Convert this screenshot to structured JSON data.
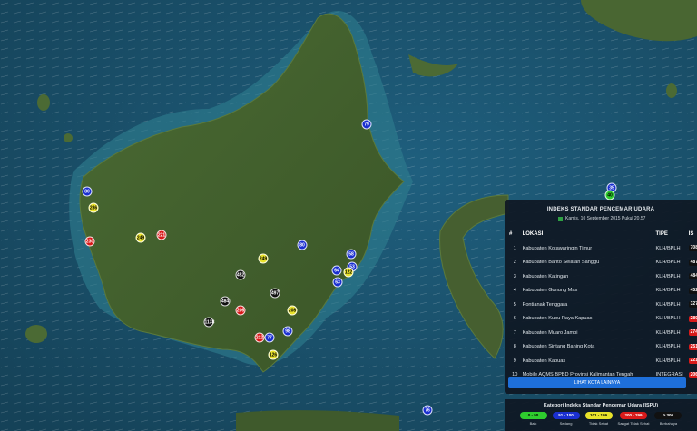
{
  "map": {
    "markers": [
      {
        "label": "79",
        "color": "#1a2fd0"
      },
      {
        "label": "80",
        "color": "#1a2fd0"
      },
      {
        "label": "286",
        "color": "#e8e22a"
      },
      {
        "label": "230",
        "color": "#d91a1a"
      },
      {
        "label": "249",
        "color": "#e8e22a"
      },
      {
        "label": "221",
        "color": "#d91a1a"
      },
      {
        "label": "80",
        "color": "#1a2fd0"
      },
      {
        "label": "58",
        "color": "#1a2fd0"
      },
      {
        "label": "249",
        "color": "#e8e22a"
      },
      {
        "label": "53",
        "color": "#1a2fd0"
      },
      {
        "label": "64",
        "color": "#1a2fd0"
      },
      {
        "label": "122",
        "color": "#e8e22a"
      },
      {
        "label": "63",
        "color": "#1a2fd0"
      },
      {
        "label": "452",
        "color": "#111111"
      },
      {
        "label": "497",
        "color": "#111111"
      },
      {
        "label": "484",
        "color": "#111111"
      },
      {
        "label": "206",
        "color": "#d91a1a"
      },
      {
        "label": "208",
        "color": "#e8e22a"
      },
      {
        "label": "1138",
        "color": "#111111"
      },
      {
        "label": "98",
        "color": "#1a2fd0"
      },
      {
        "label": "212",
        "color": "#d91a1a"
      },
      {
        "label": "77",
        "color": "#1a2fd0"
      },
      {
        "label": "126",
        "color": "#e8e22a"
      },
      {
        "label": "76",
        "color": "#1a2fd0"
      },
      {
        "label": "35",
        "color": "#1a2fd0"
      },
      {
        "label": "40",
        "color": "#2ecc2e"
      }
    ]
  },
  "panel": {
    "title": "INDEKS STANDAR PENCEMAR UDARA",
    "date": "Kamis, 10 September 2015 Pukul 20.57",
    "headers": {
      "num": "#",
      "loc": "LOKASI",
      "tipe": "TIPE",
      "ispu": "IS"
    },
    "rows": [
      {
        "num": "1",
        "loc": "Kabupaten Kotawaringin Timur",
        "tipe": "KLH/BPLH",
        "val": "708",
        "color": "#111111"
      },
      {
        "num": "2",
        "loc": "Kabupaten Barito Selatan Sanggu",
        "tipe": "KLH/BPLH",
        "val": "487",
        "color": "#111111"
      },
      {
        "num": "3",
        "loc": "Kabupaten Katingan",
        "tipe": "KLH/BPLH",
        "val": "484",
        "color": "#111111"
      },
      {
        "num": "4",
        "loc": "Kabupaten Gunung Mas",
        "tipe": "KLH/BPLH",
        "val": "452",
        "color": "#111111"
      },
      {
        "num": "5",
        "loc": "Pontianak Tenggara",
        "tipe": "KLH/BPLH",
        "val": "327",
        "color": "#111111"
      },
      {
        "num": "6",
        "loc": "Kabupaten Kubu Raya Kapuas",
        "tipe": "KLH/BPLH",
        "val": "280",
        "color": "#d91a1a"
      },
      {
        "num": "7",
        "loc": "Kabupaten Muaro Jambi",
        "tipe": "KLH/BPLH",
        "val": "274",
        "color": "#d91a1a"
      },
      {
        "num": "8",
        "loc": "Kabupaten Sintang Baning Kota",
        "tipe": "KLH/BPLH",
        "val": "251",
        "color": "#d91a1a"
      },
      {
        "num": "9",
        "loc": "Kabupaten Kapuas",
        "tipe": "KLH/BPLH",
        "val": "221",
        "color": "#d91a1a"
      },
      {
        "num": "10",
        "loc": "Mobile AQMS BPBD Provinsi Kalimantan Tengah",
        "tipe": "INTEGRASI",
        "val": "206",
        "color": "#d91a1a"
      }
    ],
    "button": "LIHAT KOTA LAINNYA"
  },
  "legend": {
    "title": "Kategori Indeks Standar Pencemar Udara (ISPU)",
    "items": [
      {
        "range": "0 - 50",
        "label": "Baik",
        "color": "#2ecc2e",
        "text": "#000000"
      },
      {
        "range": "51 - 100",
        "label": "Sedang",
        "color": "#1a2fd0",
        "text": "#ffffff"
      },
      {
        "range": "101 - 199",
        "label": "Tidak Sehat",
        "color": "#e8e22a",
        "text": "#000000"
      },
      {
        "range": "200 - 299",
        "label": "Sangat Tidak Sehat",
        "color": "#d91a1a",
        "text": "#ffffff"
      },
      {
        "range": "≥ 300",
        "label": "Berbahaya",
        "color": "#111111",
        "text": "#ffffff"
      }
    ]
  }
}
